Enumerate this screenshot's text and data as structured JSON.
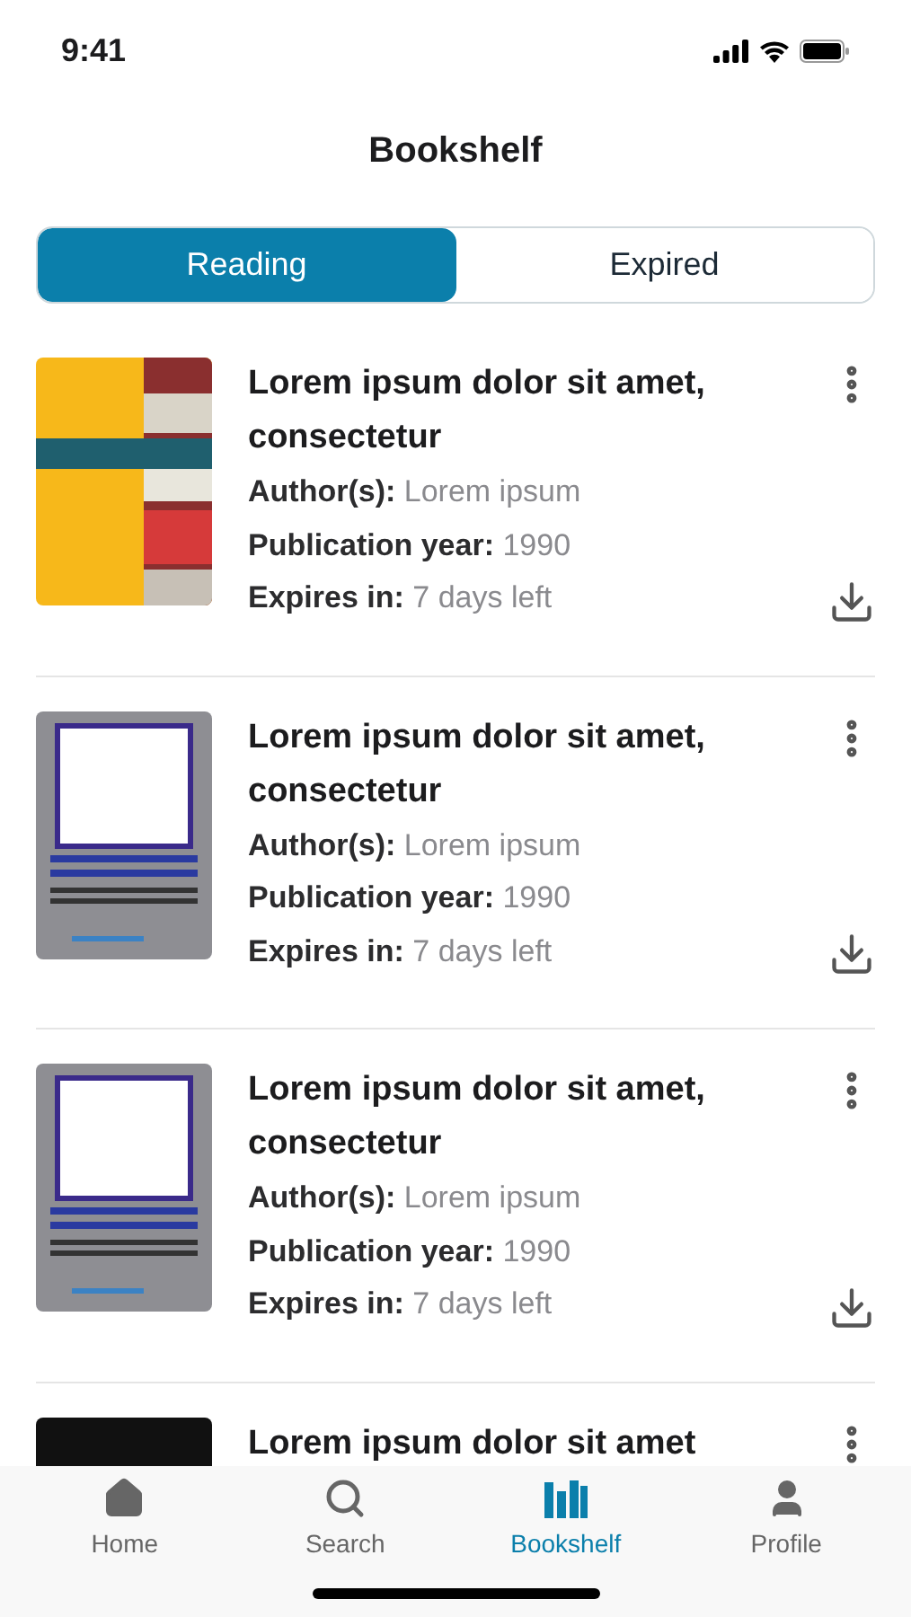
{
  "status_bar": {
    "time": "9:41"
  },
  "header": {
    "title": "Bookshelf"
  },
  "tabs": [
    {
      "label": "Reading",
      "selected": true
    },
    {
      "label": "Expired",
      "selected": false
    }
  ],
  "books": [
    {
      "title": "Lorem ipsum dolor sit amet, consectetur",
      "author_label": "Author(s):",
      "author": "Lorem ipsum",
      "year_label": "Publication year:",
      "year": "1990",
      "expires_label": "Expires in:",
      "expires": "7 days left"
    },
    {
      "title": "Lorem ipsum dolor sit amet, consectetur",
      "author_label": "Author(s):",
      "author": "Lorem ipsum",
      "year_label": "Publication year:",
      "year": "1990",
      "expires_label": "Expires in:",
      "expires": "7 days left"
    },
    {
      "title": "Lorem ipsum dolor sit amet, consectetur",
      "author_label": "Author(s):",
      "author": "Lorem ipsum",
      "year_label": "Publication year:",
      "year": "1990",
      "expires_label": "Expires in:",
      "expires": "7 days left"
    },
    {
      "title": "Lorem ipsum dolor sit amet"
    }
  ],
  "bottom_nav": [
    {
      "label": "Home",
      "kind": "home",
      "selected": false
    },
    {
      "label": "Search",
      "kind": "search",
      "selected": false
    },
    {
      "label": "Bookshelf",
      "kind": "bookshelf",
      "selected": true
    },
    {
      "label": "Profile",
      "kind": "profile",
      "selected": false
    }
  ]
}
